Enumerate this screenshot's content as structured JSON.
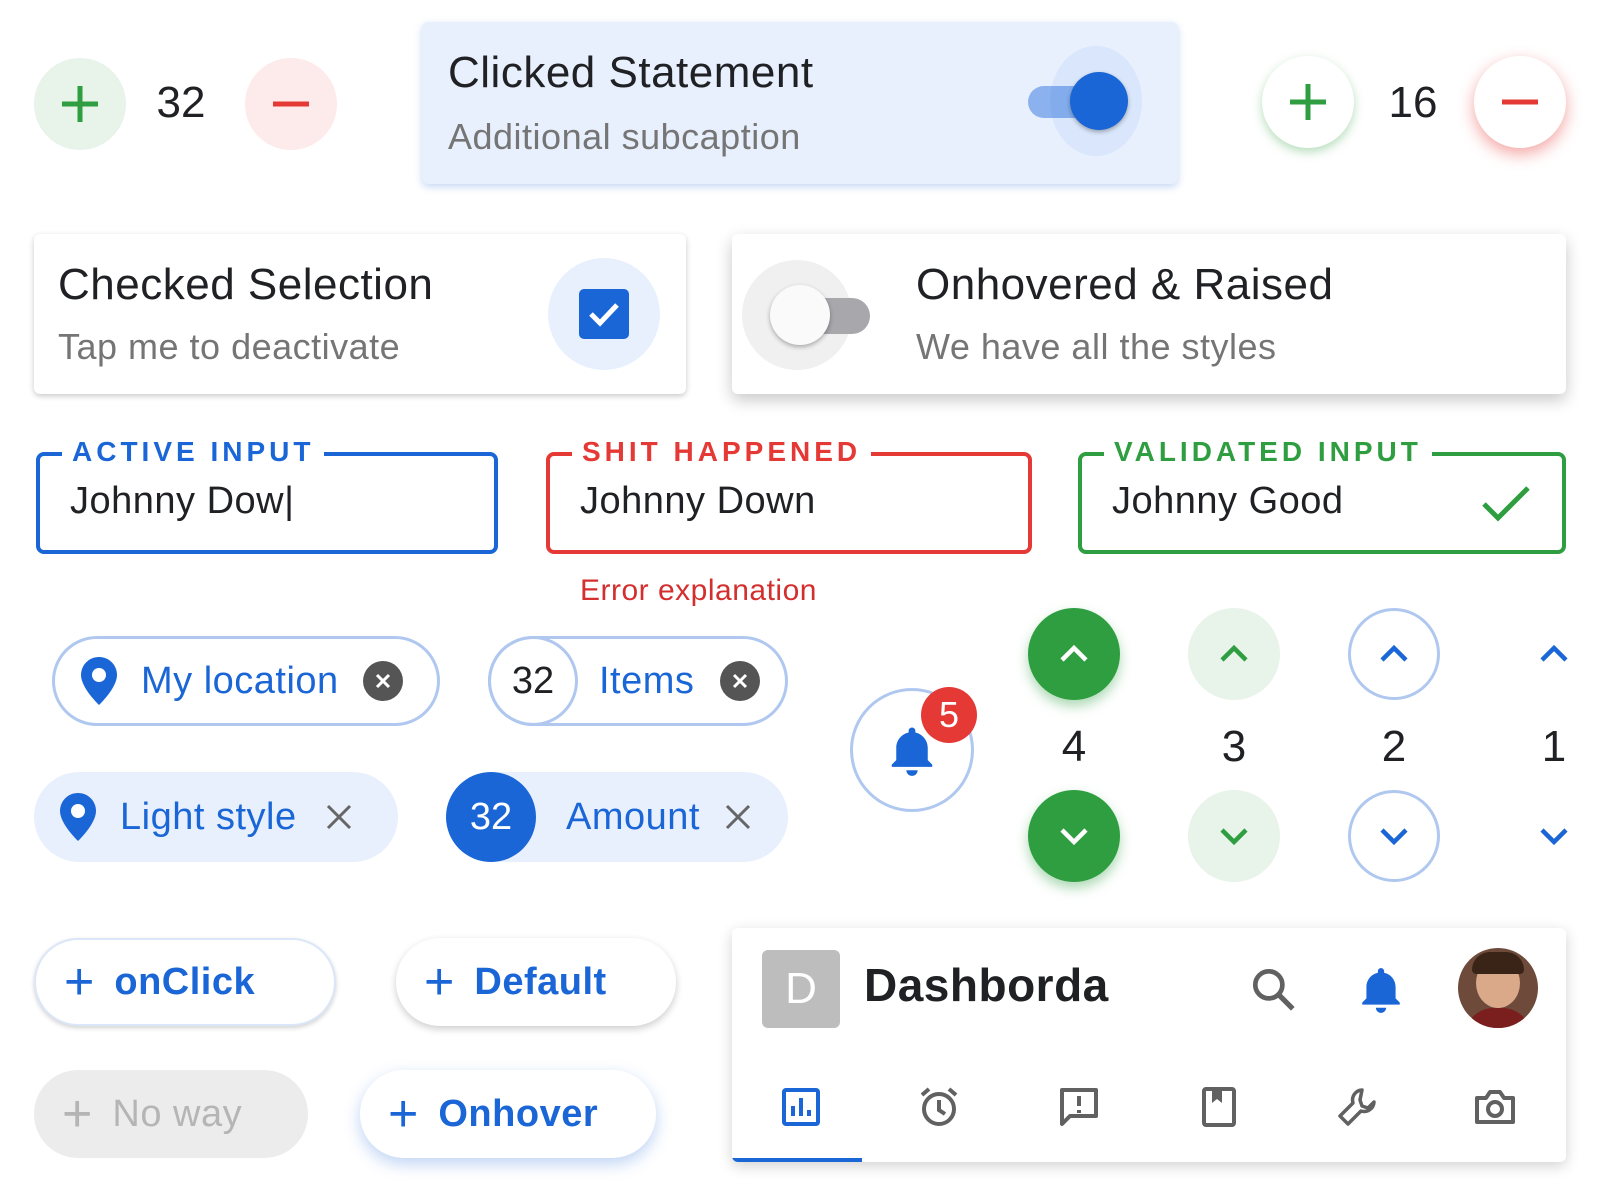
{
  "colors": {
    "primary": "#1a66d6",
    "success": "#2e9e40",
    "error": "#e53935",
    "muted": "#757575",
    "light_blue": "#e8f0fe",
    "light_green": "#e8f3ea",
    "light_red": "#fdeaea"
  },
  "counter_left": {
    "value": "32",
    "increment_icon": "plus-icon",
    "decrement_icon": "minus-icon"
  },
  "counter_right": {
    "value": "16",
    "increment_icon": "plus-icon",
    "decrement_icon": "minus-icon"
  },
  "clicked_tile": {
    "title": "Clicked Statement",
    "subtitle": "Additional subcaption",
    "switch_on": true
  },
  "checked_tile": {
    "title": "Checked Selection",
    "subtitle": "Tap me to deactivate",
    "checked": true
  },
  "hovered_tile": {
    "title": "Onhovered & Raised",
    "subtitle": "We have all the styles",
    "switch_on": false
  },
  "fields": {
    "active": {
      "label": "ACTIVE INPUT",
      "value": "Johnny Dow|"
    },
    "error": {
      "label": "SHIT HAPPENED",
      "value": "Johnny Down",
      "helper": "Error explanation"
    },
    "validated": {
      "label": "VALIDATED INPUT",
      "value": "Johnny Good"
    }
  },
  "chips": {
    "location_outlined": {
      "label": "My location",
      "icon": "location-pin-icon"
    },
    "items_outlined": {
      "count": "32",
      "label": "Items"
    },
    "location_light": {
      "label": "Light style",
      "icon": "location-pin-icon"
    },
    "amount_light": {
      "count": "32",
      "label": "Amount"
    }
  },
  "notification": {
    "badge": "5",
    "icon": "bell-icon"
  },
  "steppers": [
    {
      "value": "4",
      "style": "filled"
    },
    {
      "value": "3",
      "style": "tonal"
    },
    {
      "value": "2",
      "style": "outlined"
    },
    {
      "value": "1",
      "style": "text"
    }
  ],
  "buttons": {
    "onclick": {
      "label": "onClick"
    },
    "default": {
      "label": "Default"
    },
    "disabled": {
      "label": "No way"
    },
    "onhover": {
      "label": "Onhover"
    }
  },
  "dashboard": {
    "avatar_letter": "D",
    "title": "Dashborda",
    "tabs": [
      "chart-icon",
      "alarm-icon",
      "feedback-icon",
      "book-icon",
      "wrench-icon",
      "camera-icon"
    ],
    "active_tab": 0
  }
}
